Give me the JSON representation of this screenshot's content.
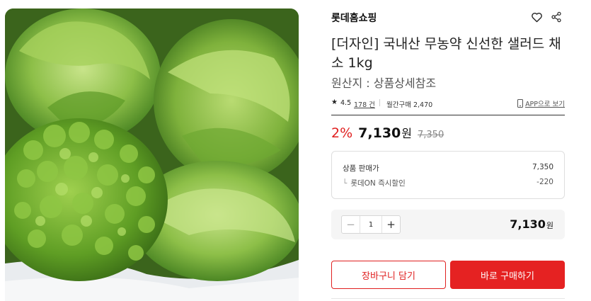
{
  "product": {
    "image_alt": "샐러드 채소 (상추, 버터헤드, 프릴 아이스)",
    "store_name": "롯데홈쇼핑",
    "title": "[더자인] 국내산 무농약 신선한 샐러드 채소 1kg",
    "origin": "원산지 : 상품상세참조"
  },
  "meta": {
    "star": "★",
    "rating": "4.5",
    "reviews": "178 건",
    "monthly_purchases": "월간구매 2,470",
    "app_link": "APP으로 보기"
  },
  "price": {
    "discount": "2%",
    "sale": "7,130",
    "currency": "원",
    "original": "7,350"
  },
  "breakdown": {
    "rows": [
      {
        "label": "상품 판매가",
        "value": "7,350"
      },
      {
        "label": "롯데ON 즉시할인",
        "value": "-220",
        "arrow": "└"
      }
    ]
  },
  "quantity": {
    "minus": "−",
    "value": "1",
    "plus": "+",
    "total": "7,130",
    "currency": "원"
  },
  "actions": {
    "cart": "장바구니 담기",
    "buy": "바로 구매하기"
  },
  "colors": {
    "accent": "#e52222",
    "discount": "#e02020",
    "lettuce_dark": "#3f6a1e",
    "lettuce_light": "#9cc95a"
  },
  "icons": {
    "wishlist": "heart-icon",
    "share": "share-icon",
    "app": "mobile-phone-icon"
  }
}
